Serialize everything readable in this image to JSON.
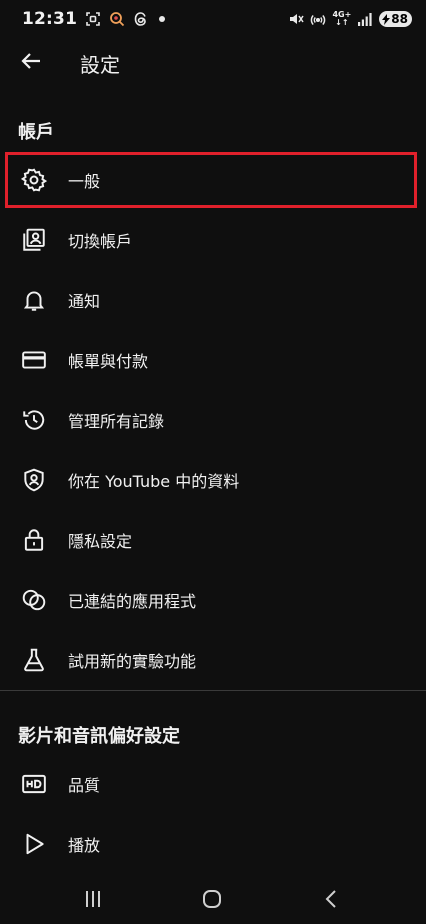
{
  "status_bar": {
    "time": "12:31",
    "network_label": "4G+",
    "battery": "88"
  },
  "header": {
    "title": "設定"
  },
  "sections": {
    "account": {
      "title": "帳戶",
      "items": [
        {
          "label": "一般",
          "icon": "gear-icon"
        },
        {
          "label": "切換帳戶",
          "icon": "switch-account-icon"
        },
        {
          "label": "通知",
          "icon": "bell-icon"
        },
        {
          "label": "帳單與付款",
          "icon": "credit-card-icon"
        },
        {
          "label": "管理所有記錄",
          "icon": "history-icon"
        },
        {
          "label": "你在 YouTube 中的資料",
          "icon": "shield-user-icon"
        },
        {
          "label": "隱私設定",
          "icon": "lock-icon"
        },
        {
          "label": "已連結的應用程式",
          "icon": "linked-circles-icon"
        },
        {
          "label": "試用新的實驗功能",
          "icon": "flask-icon"
        }
      ]
    },
    "video_audio": {
      "title": "影片和音訊偏好設定",
      "items": [
        {
          "label": "品質",
          "icon": "hd-icon"
        },
        {
          "label": "播放",
          "icon": "play-icon"
        }
      ]
    }
  },
  "colors": {
    "background": "#0f0f0f",
    "text": "#f1f1f1",
    "highlight": "#e0202b"
  }
}
